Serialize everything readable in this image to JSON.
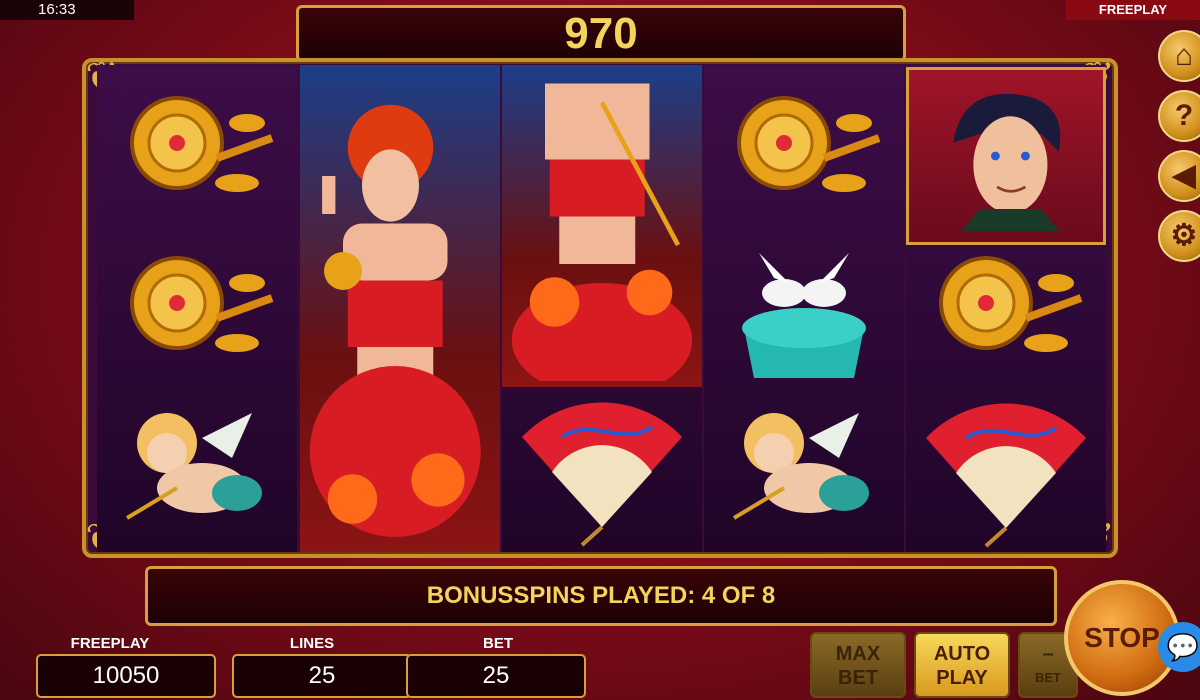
{
  "status_bar": {
    "time": "16:33",
    "mode": "FREEPLAY"
  },
  "win_display": {
    "value": "970"
  },
  "reels": [
    [
      "rose",
      "rose",
      "cupid"
    ],
    [
      "lady"
    ],
    [
      "lady",
      "fan"
    ],
    [
      "rose",
      "dove-box",
      "cupid"
    ],
    [
      "man",
      "rose",
      "fan"
    ]
  ],
  "info_bar": {
    "text": "BONUSSPINS PLAYED: 4 OF 8"
  },
  "stats": {
    "balance_label": "FREEPLAY",
    "balance_value": "10050",
    "lines_label": "LINES",
    "lines_value": "25",
    "bet_label": "BET",
    "bet_value": "25"
  },
  "buttons": {
    "max_bet_line1": "MAX",
    "max_bet_line2": "BET",
    "auto_play_line1": "AUTO",
    "auto_play_line2": "PLAY",
    "bet_minus_symbol": "–",
    "bet_minus_label": "BET",
    "stop": "STOP"
  },
  "side_icons": [
    "home-icon",
    "help-icon",
    "sound-icon",
    "settings-icon"
  ],
  "colors": {
    "gold": "#d6a13a",
    "text_gold": "#f3d45c",
    "reel_purple": "#3d0d48"
  }
}
